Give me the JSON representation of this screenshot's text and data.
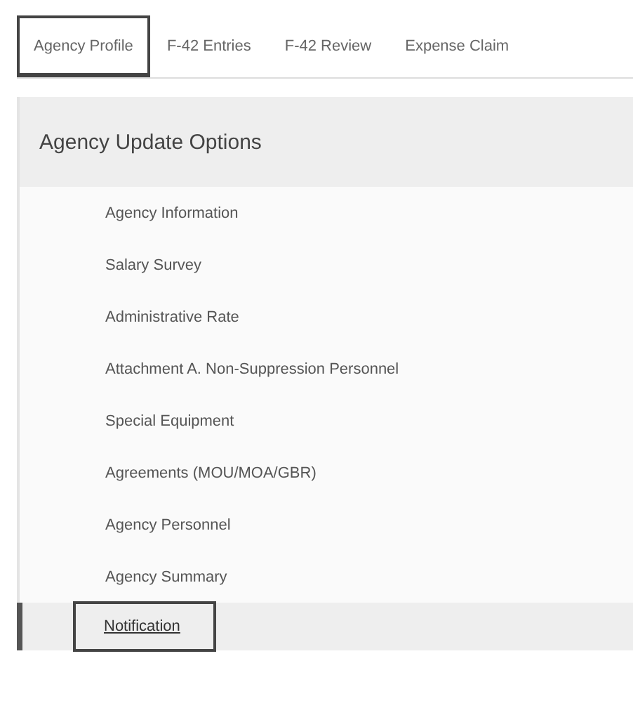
{
  "tabs": [
    {
      "label": "Agency Profile",
      "selected": true
    },
    {
      "label": "F-42 Entries",
      "selected": false
    },
    {
      "label": "F-42 Review",
      "selected": false
    },
    {
      "label": "Expense Claim",
      "selected": false
    }
  ],
  "panel": {
    "title": "Agency Update Options",
    "items": [
      {
        "label": "Agency Information",
        "selected": false
      },
      {
        "label": "Salary Survey",
        "selected": false
      },
      {
        "label": "Administrative Rate",
        "selected": false
      },
      {
        "label": "Attachment A. Non-Suppression Personnel",
        "selected": false
      },
      {
        "label": "Special Equipment",
        "selected": false
      },
      {
        "label": "Agreements (MOU/MOA/GBR)",
        "selected": false
      },
      {
        "label": "Agency Personnel",
        "selected": false
      },
      {
        "label": "Agency Summary",
        "selected": false
      },
      {
        "label": "Notification",
        "selected": true
      }
    ]
  }
}
